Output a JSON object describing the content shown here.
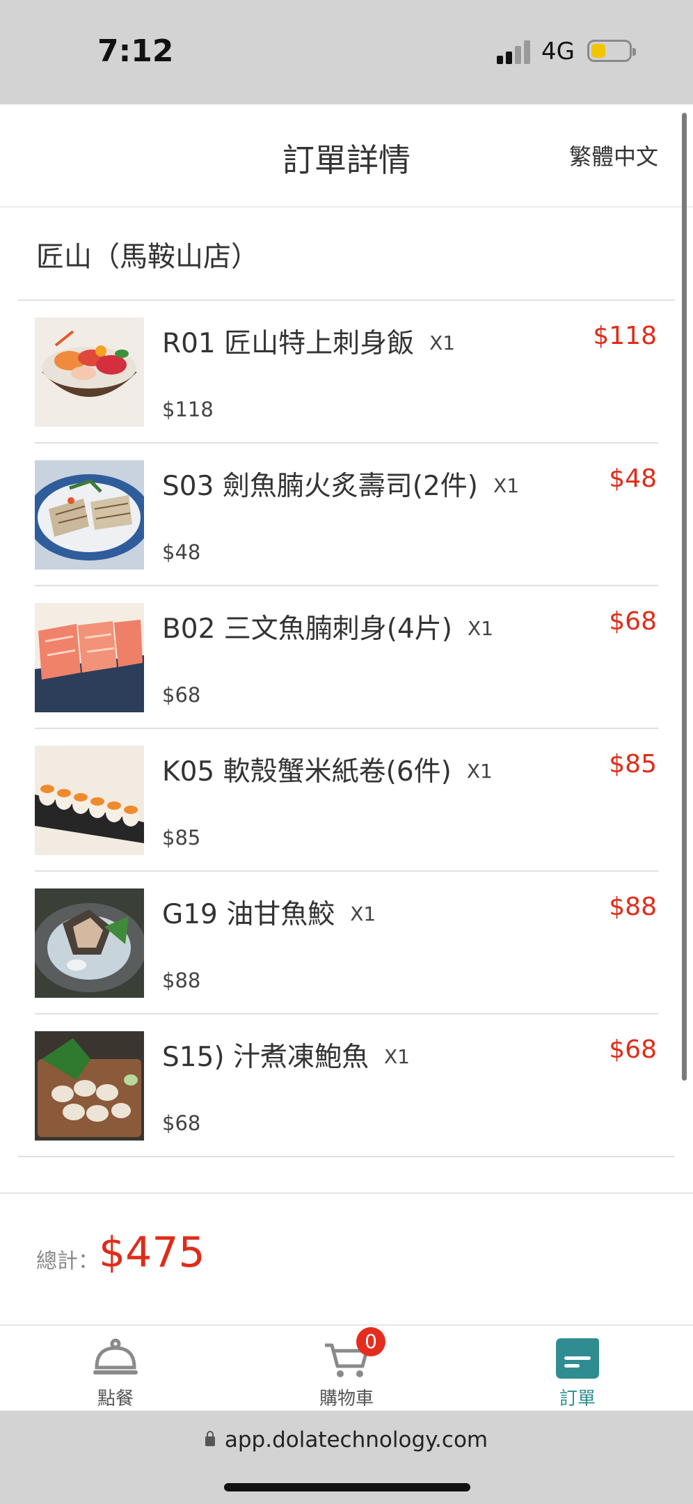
{
  "status_bar": {
    "time": "7:12",
    "network": "4G"
  },
  "header": {
    "title": "訂單詳情",
    "language": "繁體中文"
  },
  "store": {
    "name": "匠山（馬鞍山店）"
  },
  "order_items": [
    {
      "name": "R01 匠山特上刺身飯",
      "qty": "X1",
      "unit_price": "$118",
      "line_total": "$118"
    },
    {
      "name": "S03 劍魚腩火炙壽司(2件)",
      "qty": "X1",
      "unit_price": "$48",
      "line_total": "$48"
    },
    {
      "name": "B02 三文魚腩刺身(4片)",
      "qty": "X1",
      "unit_price": "$68",
      "line_total": "$68"
    },
    {
      "name": "K05 軟殼蟹米紙卷(6件)",
      "qty": "X1",
      "unit_price": "$85",
      "line_total": "$85"
    },
    {
      "name": "G19 油甘魚鮫",
      "qty": "X1",
      "unit_price": "$88",
      "line_total": "$88"
    },
    {
      "name": "S15) 汁煮凍鮑魚",
      "qty": "X1",
      "unit_price": "$68",
      "line_total": "$68"
    }
  ],
  "summary": {
    "total_label": "總計：",
    "total_value": "$475"
  },
  "tab_bar": {
    "tabs": [
      {
        "label": "點餐",
        "icon": "cloche-icon"
      },
      {
        "label": "購物車",
        "icon": "cart-icon",
        "badge": "0"
      },
      {
        "label": "訂單",
        "icon": "order-icon",
        "active": true
      }
    ]
  },
  "browser": {
    "url": "app.dolatechnology.com"
  },
  "colors": {
    "price_red": "#e02b17",
    "accent_teal": "#2f8d92",
    "badge_red": "#e52d1f"
  }
}
